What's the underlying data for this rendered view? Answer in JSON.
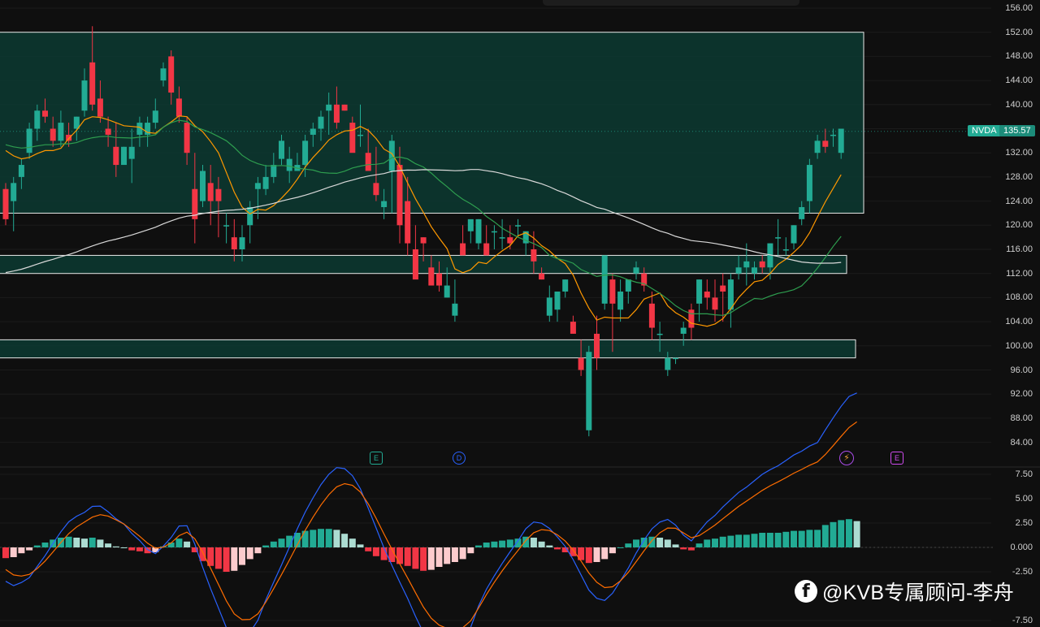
{
  "symbol": {
    "ticker": "NVDA",
    "last_price": "135.57"
  },
  "price_axis": {
    "labels": [
      "156.00",
      "152.00",
      "148.00",
      "144.00",
      "140.00",
      "136.00",
      "132.00",
      "128.00",
      "124.00",
      "120.00",
      "116.00",
      "112.00",
      "108.00",
      "104.00",
      "100.00",
      "96.00",
      "92.00",
      "88.00",
      "84.00"
    ],
    "values": [
      156,
      152,
      148,
      144,
      140,
      136,
      132,
      128,
      124,
      120,
      116,
      112,
      108,
      104,
      100,
      96,
      92,
      88,
      84
    ]
  },
  "macd_axis": {
    "labels": [
      "7.50",
      "5.00",
      "2.50",
      "0.000",
      "-2.50",
      "-7.50"
    ],
    "values": [
      7.5,
      5,
      2.5,
      0,
      -2.5,
      -7.5
    ]
  },
  "events": [
    {
      "label": "E",
      "kind": "earnings"
    },
    {
      "label": "D",
      "kind": "dividend"
    },
    {
      "label": "⚡",
      "kind": "split"
    },
    {
      "label": "E",
      "kind": "earnings-upcoming"
    }
  ],
  "watermark": {
    "icon": "facebook-icon",
    "text": "@KVB专属顾问-李舟"
  },
  "colors": {
    "up": "#22ab94",
    "down": "#f23645",
    "zone_fill": "#0c3a31",
    "ma_orange": "#ff9800",
    "ma_green": "#2e9e4f",
    "ma_white": "#d9d9d9",
    "macd_blue": "#2962ff",
    "signal_orange": "#ff6d00"
  },
  "chart_data": {
    "type": "candlestick",
    "series": [
      {
        "name": "NVDA",
        "ohlc": [
          [
            126,
            127,
            120,
            121
          ],
          [
            124,
            128,
            119,
            127
          ],
          [
            128,
            131,
            126,
            130
          ],
          [
            132,
            137,
            131,
            136
          ],
          [
            136,
            140,
            134,
            139
          ],
          [
            139,
            141,
            137,
            138
          ],
          [
            136,
            138,
            133,
            134
          ],
          [
            134,
            139,
            133,
            137
          ],
          [
            135,
            137,
            133,
            134
          ],
          [
            136,
            138,
            134,
            138
          ],
          [
            139,
            146,
            138,
            144
          ],
          [
            147,
            153,
            139,
            140
          ],
          [
            141,
            144,
            137,
            138
          ],
          [
            136,
            138,
            133,
            135
          ],
          [
            133,
            137,
            128,
            130
          ],
          [
            130,
            133,
            130,
            133
          ],
          [
            131,
            136,
            127,
            133
          ],
          [
            135,
            138,
            133,
            137
          ],
          [
            135,
            138,
            133,
            137
          ],
          [
            137,
            141,
            136,
            139
          ],
          [
            144,
            147,
            143,
            146
          ],
          [
            148,
            149,
            140,
            142
          ],
          [
            141,
            143,
            137,
            138
          ],
          [
            137,
            138,
            130,
            132
          ],
          [
            126,
            132,
            117,
            121
          ],
          [
            124,
            130,
            123,
            129
          ],
          [
            127,
            130,
            120,
            124
          ],
          [
            126,
            128,
            118,
            124
          ],
          [
            120,
            122,
            117,
            120
          ],
          [
            118,
            121,
            114,
            116
          ],
          [
            116,
            120,
            114,
            118
          ],
          [
            120,
            124,
            117,
            123
          ],
          [
            126,
            128,
            121,
            127
          ],
          [
            126,
            130,
            125,
            128
          ],
          [
            128,
            132,
            127,
            130
          ],
          [
            131,
            135,
            130,
            134
          ],
          [
            129,
            133,
            127,
            131
          ],
          [
            129,
            132,
            129,
            130
          ],
          [
            130,
            135,
            128,
            134
          ],
          [
            135,
            137,
            133,
            136
          ],
          [
            136,
            139,
            134,
            138
          ],
          [
            139,
            142,
            135,
            140
          ],
          [
            140,
            143,
            136,
            137
          ],
          [
            140,
            140,
            139,
            139
          ],
          [
            137,
            138,
            133,
            132
          ],
          [
            135,
            140,
            133,
            135
          ],
          [
            132,
            136,
            131,
            129
          ],
          [
            127,
            133,
            124,
            125
          ],
          [
            123,
            126,
            121,
            124
          ],
          [
            129,
            135,
            122,
            134
          ],
          [
            130,
            133,
            117,
            120
          ],
          [
            124,
            128,
            115,
            117
          ],
          [
            116,
            120,
            115,
            111
          ],
          [
            118,
            118,
            114,
            117
          ],
          [
            113,
            115,
            111,
            110
          ],
          [
            112,
            114,
            109,
            110
          ],
          [
            108,
            113,
            108,
            110
          ],
          [
            105,
            111,
            104,
            107
          ],
          [
            117,
            120,
            115,
            115
          ],
          [
            119,
            120,
            117,
            121
          ],
          [
            117,
            121,
            116,
            121
          ],
          [
            117,
            120,
            115,
            115
          ],
          [
            119,
            120,
            116,
            119
          ],
          [
            118,
            121,
            116,
            118
          ],
          [
            118,
            120,
            116,
            117
          ],
          [
            120,
            121,
            118,
            120
          ],
          [
            117,
            118,
            115,
            119
          ],
          [
            116,
            119,
            112,
            114
          ],
          [
            112,
            113,
            111,
            111
          ],
          [
            105,
            110,
            104,
            108
          ],
          [
            106,
            109,
            104,
            109
          ],
          [
            109,
            111,
            108,
            111
          ],
          [
            104,
            105,
            102,
            102
          ],
          [
            98,
            101,
            95,
            96
          ],
          [
            86,
            100,
            85,
            99
          ],
          [
            102,
            105,
            96,
            98
          ],
          [
            107,
            115,
            106,
            115
          ],
          [
            111,
            112,
            99,
            107
          ],
          [
            106,
            111,
            104,
            109
          ],
          [
            109,
            111,
            107,
            111
          ],
          [
            112,
            114,
            111,
            113
          ],
          [
            112,
            113,
            109,
            110
          ],
          [
            107,
            109,
            101,
            103
          ],
          [
            102,
            104,
            99,
            102
          ],
          [
            96,
            99,
            95,
            98
          ],
          [
            98,
            98,
            97,
            98
          ],
          [
            102,
            104,
            100,
            103
          ],
          [
            106,
            107,
            101,
            103
          ],
          [
            107,
            111,
            104,
            111
          ],
          [
            109,
            111,
            106,
            108
          ],
          [
            108,
            111,
            104,
            106
          ],
          [
            110,
            112,
            104,
            109
          ],
          [
            106,
            112,
            103,
            111
          ],
          [
            112,
            115,
            111,
            113
          ],
          [
            113,
            117,
            110,
            114
          ],
          [
            112,
            114,
            111,
            113
          ],
          [
            114,
            115,
            112,
            113
          ],
          [
            113,
            117,
            111,
            117
          ],
          [
            118,
            121,
            115,
            118
          ],
          [
            116,
            118,
            115,
            116
          ],
          [
            117,
            120,
            116,
            120
          ],
          [
            121,
            124,
            120,
            123
          ],
          [
            124,
            131,
            122,
            130
          ],
          [
            132,
            135,
            131,
            134
          ],
          [
            134,
            136,
            132,
            133
          ],
          [
            135,
            136,
            133,
            135
          ],
          [
            132,
            136,
            131,
            136
          ]
        ]
      },
      {
        "name": "MA short",
        "values": []
      },
      {
        "name": "MA mid",
        "values": []
      },
      {
        "name": "MA long",
        "values": []
      }
    ],
    "zones": [
      {
        "top": 152,
        "bottom": 122
      },
      {
        "top": 115,
        "bottom": 112
      },
      {
        "top": 101,
        "bottom": 98
      }
    ],
    "macd": {
      "hist": [
        -1.1,
        -1.0,
        -0.6,
        -0.3,
        0.2,
        0.5,
        0.8,
        1.0,
        1.1,
        1.0,
        0.9,
        1.0,
        0.8,
        0.4,
        0.1,
        0.0,
        -0.3,
        -0.4,
        -0.6,
        -0.5,
        0.1,
        0.5,
        0.9,
        0.6,
        -0.5,
        -1.4,
        -1.9,
        -2.2,
        -2.5,
        -2.4,
        -1.8,
        -1.2,
        -0.6,
        0.2,
        0.6,
        0.9,
        1.2,
        1.5,
        1.7,
        1.8,
        1.9,
        1.9,
        1.8,
        1.4,
        0.9,
        0.3,
        -0.4,
        -0.9,
        -1.3,
        -1.5,
        -1.7,
        -1.9,
        -2.2,
        -2.4,
        -2.3,
        -2.0,
        -1.7,
        -1.5,
        -1.2,
        -0.6,
        0.2,
        0.5,
        0.6,
        0.7,
        0.8,
        0.9,
        1.1,
        1.0,
        0.6,
        0.2,
        -0.2,
        -0.5,
        -0.9,
        -1.3,
        -1.6,
        -1.5,
        -1.2,
        -0.6,
        0.0,
        0.4,
        0.8,
        1.0,
        1.1,
        1.0,
        0.8,
        0.3,
        -0.2,
        -0.3,
        0.4,
        0.8,
        0.9,
        1.1,
        1.2,
        1.3,
        1.3,
        1.4,
        1.5,
        1.5,
        1.5,
        1.6,
        1.7,
        1.7,
        1.8,
        1.8,
        2.3,
        2.6,
        2.8,
        2.9,
        2.7
      ]
    }
  }
}
